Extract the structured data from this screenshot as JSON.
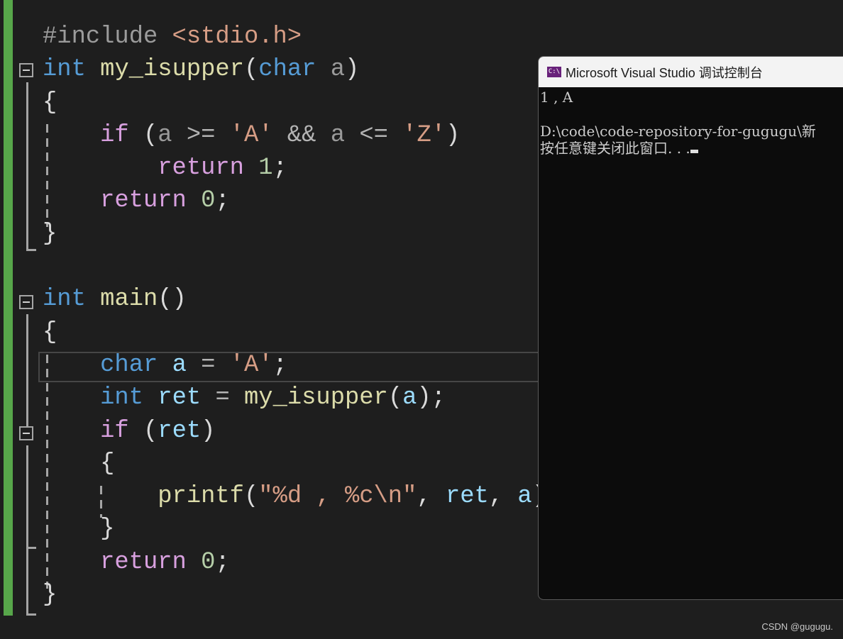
{
  "editor": {
    "lines": [
      [
        {
          "t": "#include ",
          "c": "pp"
        },
        {
          "t": "<stdio.h>",
          "c": "str"
        }
      ],
      [
        {
          "t": "int",
          "c": "kw"
        },
        {
          "t": " ",
          "c": "pl"
        },
        {
          "t": "my_isupper",
          "c": "fn"
        },
        {
          "t": "(",
          "c": "pl"
        },
        {
          "t": "char",
          "c": "kw"
        },
        {
          "t": " a",
          "c": "par"
        },
        {
          "t": ")",
          "c": "pl"
        }
      ],
      [
        {
          "t": "{",
          "c": "pl"
        }
      ],
      [
        {
          "t": "    ",
          "c": "pl"
        },
        {
          "t": "if",
          "c": "ctl"
        },
        {
          "t": " (",
          "c": "pl"
        },
        {
          "t": "a",
          "c": "par"
        },
        {
          "t": " >= ",
          "c": "op"
        },
        {
          "t": "'A'",
          "c": "str"
        },
        {
          "t": " && ",
          "c": "op"
        },
        {
          "t": "a",
          "c": "par"
        },
        {
          "t": " <= ",
          "c": "op"
        },
        {
          "t": "'Z'",
          "c": "str"
        },
        {
          "t": ")",
          "c": "pl"
        }
      ],
      [
        {
          "t": "        ",
          "c": "pl"
        },
        {
          "t": "return",
          "c": "ctl"
        },
        {
          "t": " ",
          "c": "pl"
        },
        {
          "t": "1",
          "c": "num"
        },
        {
          "t": ";",
          "c": "pl"
        }
      ],
      [
        {
          "t": "    ",
          "c": "pl"
        },
        {
          "t": "return",
          "c": "ctl"
        },
        {
          "t": " ",
          "c": "pl"
        },
        {
          "t": "0",
          "c": "num"
        },
        {
          "t": ";",
          "c": "pl"
        }
      ],
      [
        {
          "t": "}",
          "c": "pl"
        }
      ],
      [],
      [
        {
          "t": "int",
          "c": "kw"
        },
        {
          "t": " ",
          "c": "pl"
        },
        {
          "t": "main",
          "c": "fn"
        },
        {
          "t": "()",
          "c": "pl"
        }
      ],
      [
        {
          "t": "{",
          "c": "pl"
        }
      ],
      [
        {
          "t": "    ",
          "c": "pl"
        },
        {
          "t": "char",
          "c": "kw"
        },
        {
          "t": " ",
          "c": "pl"
        },
        {
          "t": "a",
          "c": "var"
        },
        {
          "t": " = ",
          "c": "op"
        },
        {
          "t": "'A'",
          "c": "str"
        },
        {
          "t": ";",
          "c": "pl"
        }
      ],
      [
        {
          "t": "    ",
          "c": "pl"
        },
        {
          "t": "int",
          "c": "kw"
        },
        {
          "t": " ",
          "c": "pl"
        },
        {
          "t": "ret",
          "c": "var"
        },
        {
          "t": " = ",
          "c": "op"
        },
        {
          "t": "my_isupper",
          "c": "fn"
        },
        {
          "t": "(",
          "c": "pl"
        },
        {
          "t": "a",
          "c": "var"
        },
        {
          "t": ");",
          "c": "pl"
        }
      ],
      [
        {
          "t": "    ",
          "c": "pl"
        },
        {
          "t": "if",
          "c": "ctl"
        },
        {
          "t": " (",
          "c": "pl"
        },
        {
          "t": "ret",
          "c": "var"
        },
        {
          "t": ")",
          "c": "pl"
        }
      ],
      [
        {
          "t": "    ",
          "c": "pl"
        },
        {
          "t": "{",
          "c": "pl"
        }
      ],
      [
        {
          "t": "        ",
          "c": "pl"
        },
        {
          "t": "printf",
          "c": "fn"
        },
        {
          "t": "(",
          "c": "pl"
        },
        {
          "t": "\"%d , %c\\n\"",
          "c": "str"
        },
        {
          "t": ", ",
          "c": "pl"
        },
        {
          "t": "ret",
          "c": "var"
        },
        {
          "t": ", ",
          "c": "pl"
        },
        {
          "t": "a",
          "c": "var"
        },
        {
          "t": ");",
          "c": "pl"
        }
      ],
      [
        {
          "t": "    ",
          "c": "pl"
        },
        {
          "t": "}",
          "c": "pl"
        }
      ],
      [
        {
          "t": "    ",
          "c": "pl"
        },
        {
          "t": "return",
          "c": "ctl"
        },
        {
          "t": " ",
          "c": "pl"
        },
        {
          "t": "0",
          "c": "num"
        },
        {
          "t": ";",
          "c": "pl"
        }
      ],
      [
        {
          "t": "}",
          "c": "pl"
        }
      ]
    ]
  },
  "console": {
    "title": "Microsoft Visual Studio 调试控制台",
    "icon": "console-app-icon",
    "icon_text": "C:\\",
    "output": [
      "1 , A",
      "",
      "D:\\code\\code-repository-for-gugugu\\新",
      "按任意键关闭此窗口. . ."
    ]
  },
  "watermark": "CSDN @gugugu."
}
